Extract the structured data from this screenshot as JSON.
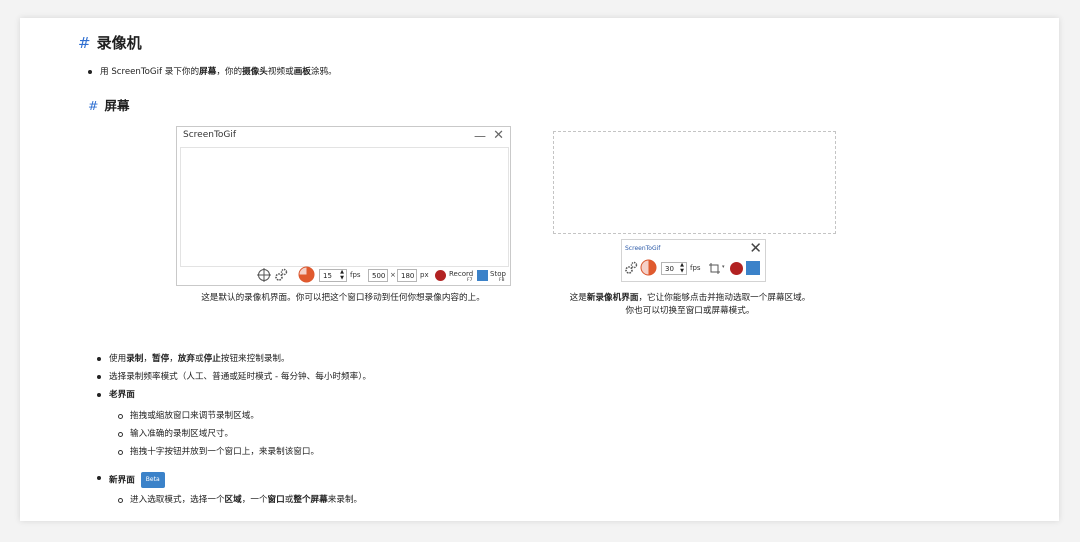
{
  "heading": {
    "hash": "#",
    "title": "录像机"
  },
  "intro": {
    "p1": "用 ScreenToGif 录下你的",
    "b1": "屏幕",
    "p2": "，你的",
    "b2": "摄像头",
    "p3": "视频或",
    "b3": "画板",
    "p4": "涂鸦。"
  },
  "section": {
    "hash": "#",
    "title": "屏幕"
  },
  "old_recorder": {
    "title": "ScreenToGif",
    "minimize": "—",
    "close": "✕",
    "fps_value": "15",
    "fps_label": "fps",
    "width_value": "500",
    "times": "×",
    "height_value": "180",
    "px_label": "px",
    "record_label": "Record",
    "record_key": "F7",
    "stop_label": "Stop",
    "stop_key": "F8",
    "caption": "这是默认的录像机界面。你可以把这个窗口移动到任何你想录像内容的上。"
  },
  "new_recorder": {
    "title": "ScreenToGif",
    "close": "✕",
    "fps_value": "30",
    "fps_label": "fps",
    "caption_p1": "这是",
    "caption_b": "新录像机界面",
    "caption_p2": "，它让你能够点击并拖动选取一个屏幕区域。",
    "caption_line2": "你也可以切换至窗口或屏幕模式。"
  },
  "bullets": {
    "b1": {
      "p1": "使用",
      "b1": "录制",
      "s1": "，",
      "b2": "暂停",
      "s2": "，",
      "b3": "放弃",
      "s3": "或",
      "b4": "停止",
      "p2": "按钮来控制录制。"
    },
    "b2": "选择录制频率模式（人工、普通或延时模式 - 每分钟、每小时频率）。",
    "b3": "老界面",
    "b3_subs": [
      "拖拽或缩放窗口来调节录制区域。",
      "输入准确的录制区域尺寸。",
      "拖拽十字按钮并放到一个窗口上，来录制该窗口。"
    ],
    "b4": "新界面",
    "beta": "Beta",
    "b4_sub": {
      "p1": "进入选取模式，选择一个",
      "b1": "区域",
      "p2": "，一个",
      "b2": "窗口",
      "p3": "或",
      "b3": "整个屏幕",
      "p4": "来录制。"
    }
  },
  "colors": {
    "accent": "#2f6fd1",
    "record": "#b22222",
    "stop": "#3b82c9"
  }
}
